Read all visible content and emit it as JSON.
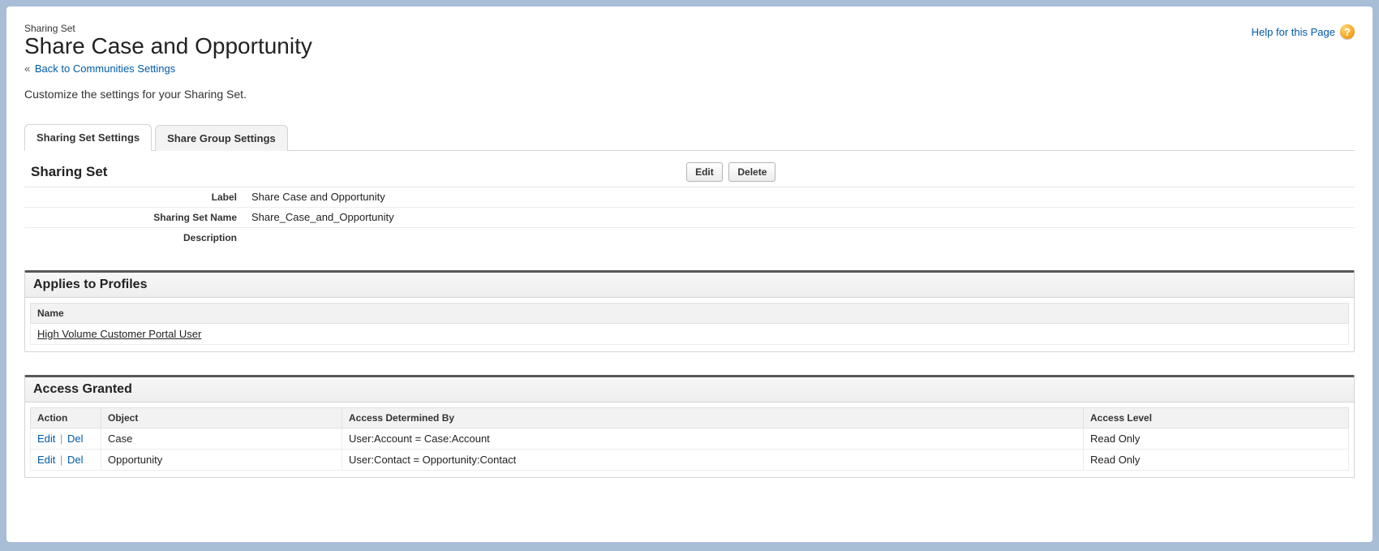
{
  "header": {
    "eyebrow": "Sharing Set",
    "title": "Share Case and Opportunity",
    "back_link": "Back to Communities Settings",
    "back_chevron": "«",
    "help_link": "Help for this Page",
    "help_glyph": "?"
  },
  "intro": "Customize the settings for your Sharing Set.",
  "tabs": {
    "settings": "Sharing Set Settings",
    "group": "Share Group Settings"
  },
  "detail": {
    "section_title": "Sharing Set",
    "buttons": {
      "edit": "Edit",
      "delete": "Delete"
    },
    "fields": {
      "label_lbl": "Label",
      "label_val": "Share Case and Opportunity",
      "name_lbl": "Sharing Set Name",
      "name_val": "Share_Case_and_Opportunity",
      "desc_lbl": "Description",
      "desc_val": ""
    }
  },
  "profiles": {
    "title": "Applies to Profiles",
    "col_name": "Name",
    "rows": [
      {
        "name": "High Volume Customer Portal User"
      }
    ]
  },
  "access": {
    "title": "Access Granted",
    "columns": {
      "action": "Action",
      "object": "Object",
      "determined_by": "Access Determined By",
      "level": "Access Level"
    },
    "action_edit": "Edit",
    "action_del": "Del",
    "action_sep": "|",
    "rows": [
      {
        "object": "Case",
        "determined_by": "User:Account = Case:Account",
        "level": "Read Only"
      },
      {
        "object": "Opportunity",
        "determined_by": "User:Contact = Opportunity:Contact",
        "level": "Read Only"
      }
    ]
  }
}
